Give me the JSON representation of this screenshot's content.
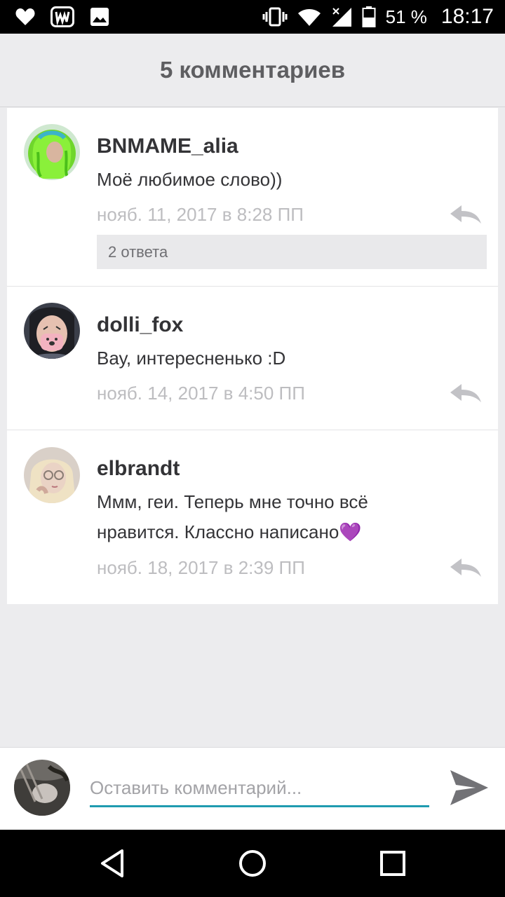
{
  "status_bar": {
    "battery": "51 %",
    "time": "18:17"
  },
  "header": {
    "title": "5 комментариев"
  },
  "comments": [
    {
      "username": "BNMAME_alia",
      "text": "Моё любимое слово))",
      "time": "нояб. 11, 2017 в 8:28 ПП",
      "replies": "2 ответа"
    },
    {
      "username": "dolli_fox",
      "text": "Вау, интересненько :D",
      "time": "нояб. 14, 2017 в 4:50 ПП"
    },
    {
      "username": "elbrandt",
      "text": "Ммм, геи. Теперь мне точно всё нравится. Классно написано💜",
      "time": "нояб. 18, 2017 в 2:39 ПП"
    }
  ],
  "composer": {
    "placeholder": "Оставить комментарий..."
  },
  "colors": {
    "accent": "#1f9bb0",
    "header_bg": "#ececee",
    "title": "#5e5e61",
    "timestamp": "#bdbdc0"
  }
}
